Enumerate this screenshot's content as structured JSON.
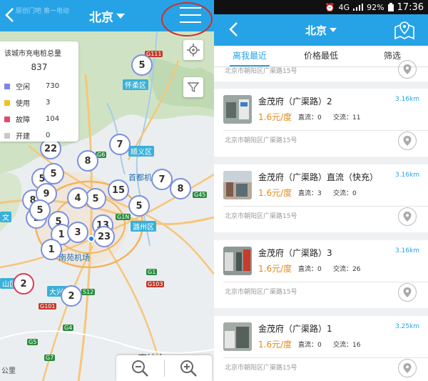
{
  "left": {
    "watermark": "原创门吧 第一电动",
    "city": "北京",
    "legend": {
      "title": "该城市充电桩总量",
      "total": "837",
      "rows": [
        {
          "label": "空闲",
          "count": "730",
          "color": "#7b86e8"
        },
        {
          "label": "使用",
          "count": "3",
          "color": "#f3c21f"
        },
        {
          "label": "故障",
          "count": "104",
          "color": "#e04a6b"
        },
        {
          "label": "开建",
          "count": "0",
          "color": "#c8c8c8"
        }
      ]
    },
    "clusters": [
      "5",
      "22",
      "8",
      "7",
      "5",
      "5",
      "7",
      "8",
      "15",
      "5",
      "4",
      "5",
      "8",
      "9",
      "5",
      "1",
      "5",
      "1",
      "3",
      "13",
      "23",
      "1",
      "2",
      "2",
      "5"
    ],
    "places": {
      "huairou": "怀柔区",
      "shunyi": "顺义区",
      "airport1": "首都机场",
      "tongzhou": "潞州区",
      "nanyuan": "南苑机场",
      "daxing": "大兴区",
      "langfang": "廊坊市",
      "shanqu": "山区",
      "wen": "文",
      "gong": "公里"
    },
    "shields": [
      "G111",
      "G6",
      "G45",
      "G1N",
      "G1",
      "G103",
      "G101",
      "G4",
      "G5",
      "G7",
      "S12"
    ]
  },
  "right": {
    "status": {
      "net": "4G",
      "battery": "92%",
      "time": "17:36"
    },
    "city": "北京",
    "tabs": [
      {
        "label": "离我最近",
        "active": true
      },
      {
        "label": "价格最低",
        "active": false
      },
      {
        "label": "筛选",
        "active": false
      }
    ],
    "partial_address": "北京市朝阳区广渠路15号",
    "cards": [
      {
        "name": "金茂府（广渠路）2",
        "dist": "3.16km",
        "price": "1.6元/度",
        "dc": "直流：0",
        "ac": "交流：11",
        "addr": "北京市朝阳区广渠路15号"
      },
      {
        "name": "金茂府（广渠路）直流（快充）",
        "dist": "3.16km",
        "price": "1.6元/度",
        "dc": "直流：3",
        "ac": "交流：0",
        "addr": "北京市朝阳区广渠路15号"
      },
      {
        "name": "金茂府（广渠路）3",
        "dist": "3.16km",
        "price": "1.6元/度",
        "dc": "直流：0",
        "ac": "交流：26",
        "addr": "北京市朝阳区广渠路15号"
      },
      {
        "name": "金茂府（广渠路）1",
        "dist": "3.25km",
        "price": "1.6元/度",
        "dc": "直流：0",
        "ac": "交流：16",
        "addr": "北京市朝阳区广渠路15号"
      }
    ]
  }
}
